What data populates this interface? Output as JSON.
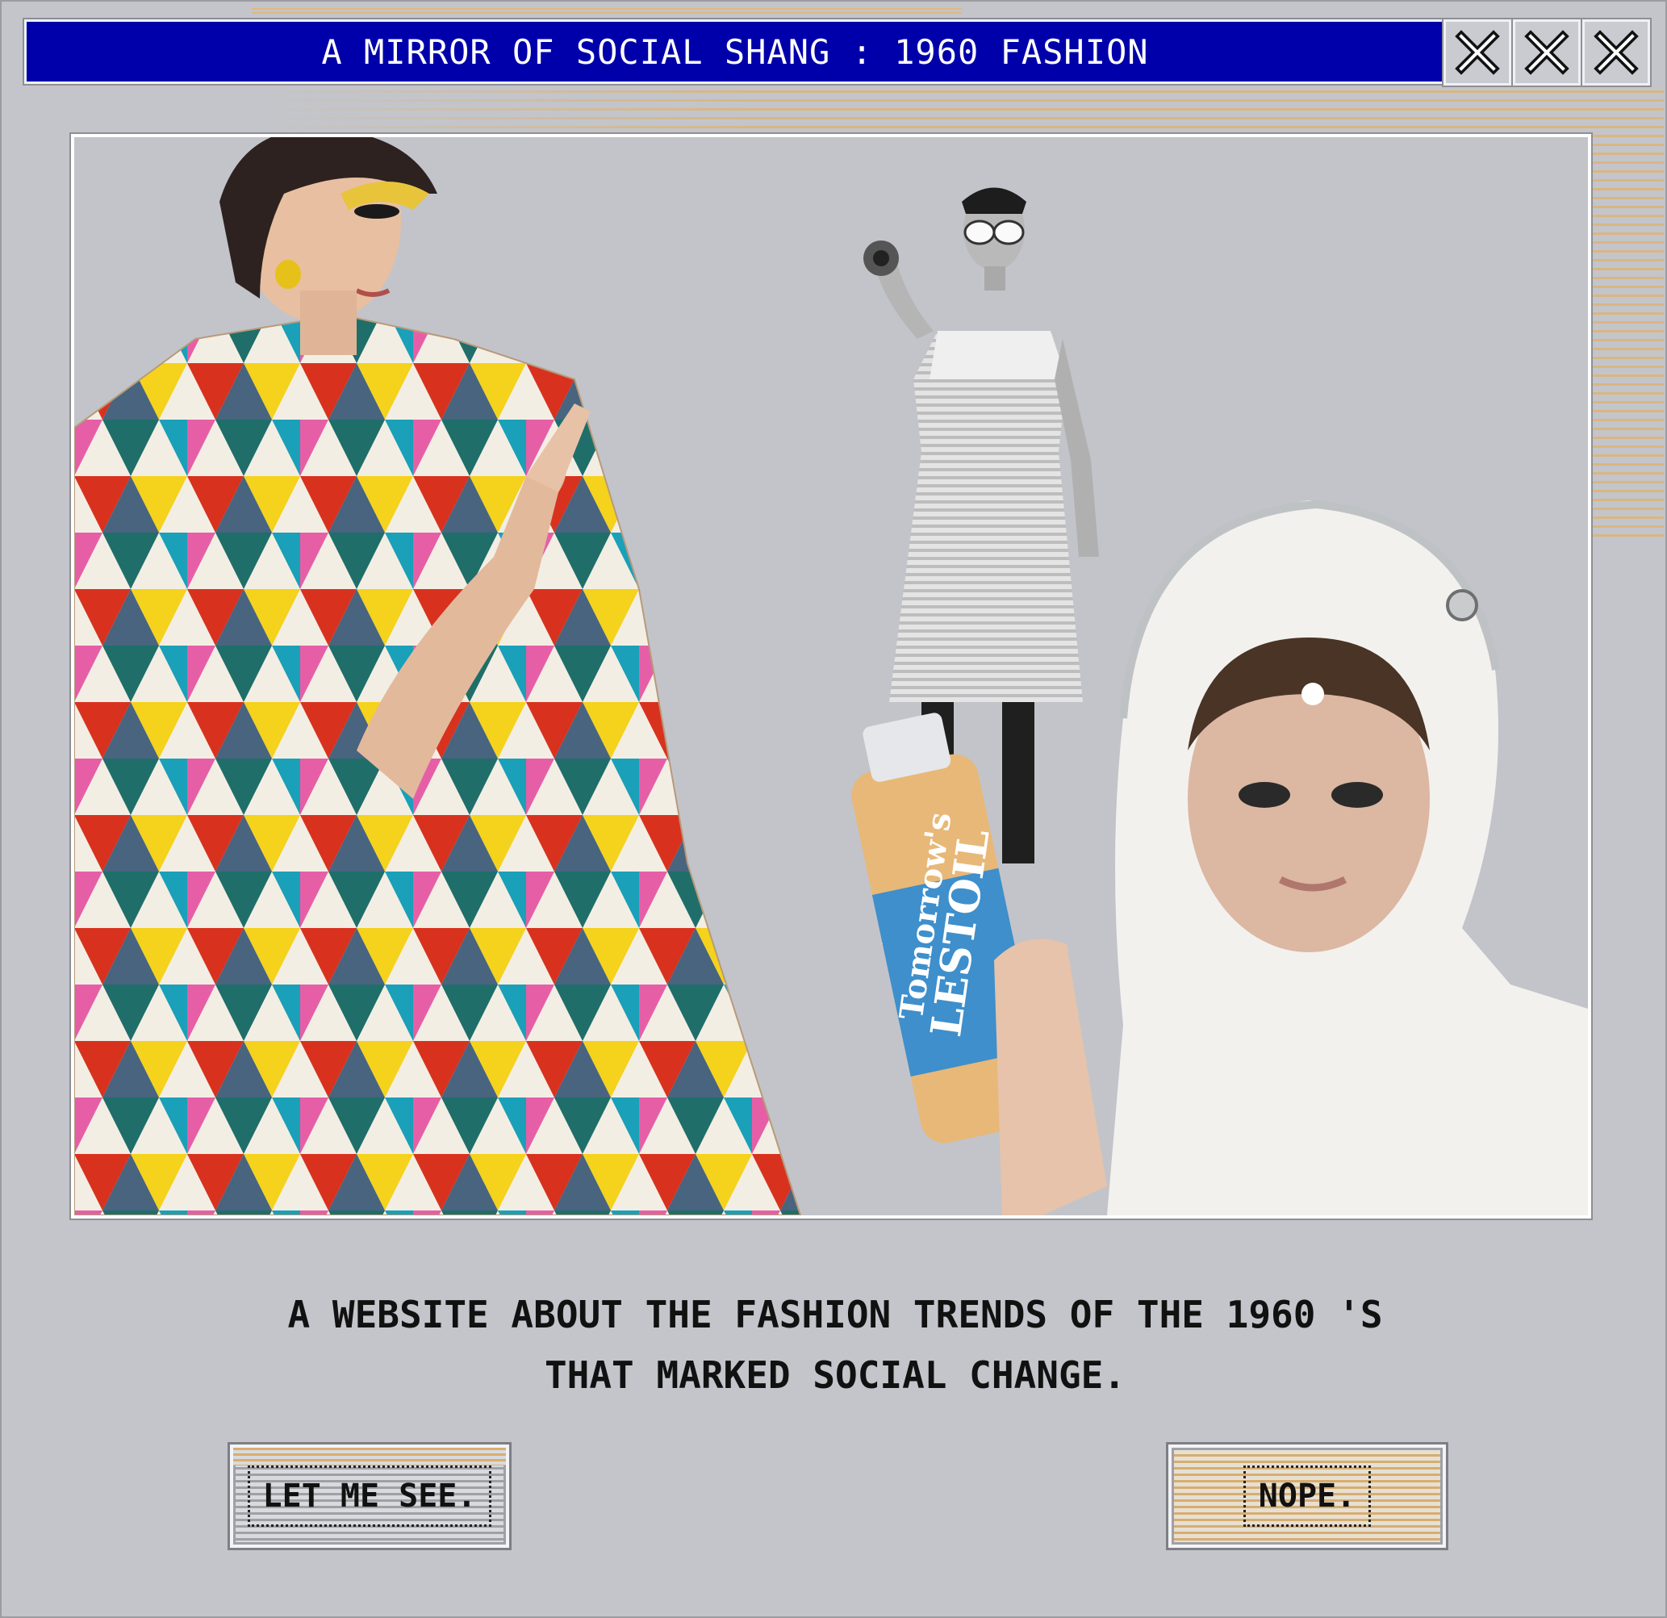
{
  "window": {
    "title": "A MIRROR OF SOCIAL SHANG : 1960 FASHION",
    "controls": [
      "close-icon",
      "close-icon",
      "close-icon"
    ],
    "title_bar_color": "#0000aa",
    "background_color": "#c3c5cb",
    "stripe_accent_color": "#dcb57a"
  },
  "collage": {
    "bottle_label": [
      "Tomorrow's",
      "LESTOIL"
    ]
  },
  "intro": {
    "line1": "A WEBSITE ABOUT THE FASHION TRENDS OF THE 1960 'S",
    "line2": "THAT MARKED SOCIAL CHANGE."
  },
  "buttons": {
    "see_label": "LET ME SEE.",
    "nope_label": "NOPE."
  }
}
